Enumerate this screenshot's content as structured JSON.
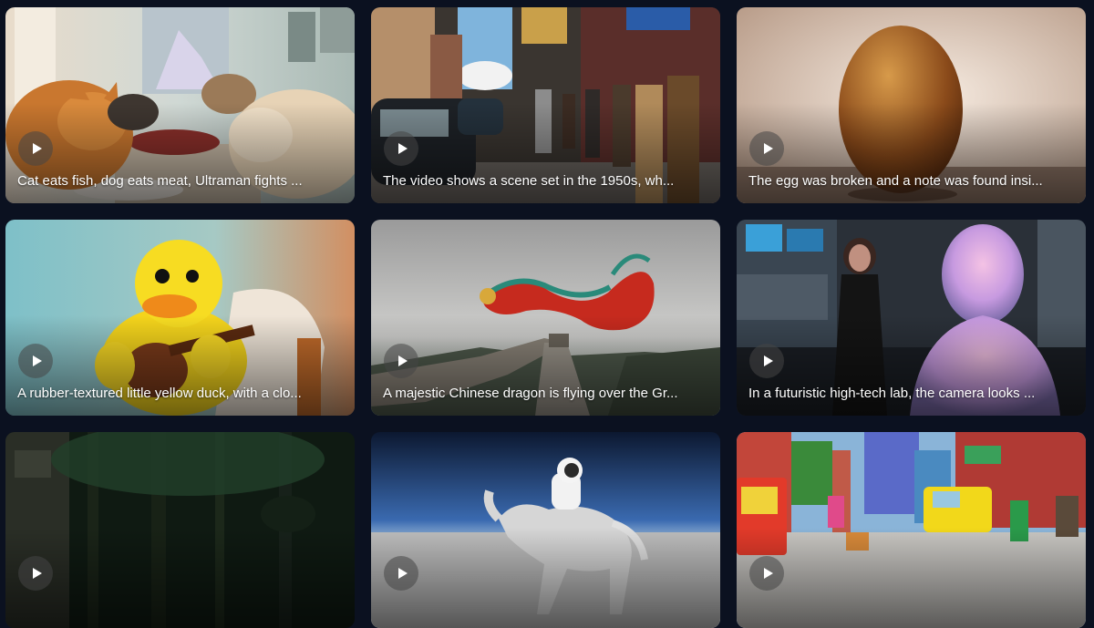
{
  "colors": {
    "page_background": "#0b1120",
    "caption_text": "#ffffff"
  },
  "gallery": {
    "cards": [
      {
        "caption": "Cat eats fish, dog eats meat, Ultraman fights ...",
        "play_icon": "play-icon"
      },
      {
        "caption": "The video shows a scene set in the 1950s, wh...",
        "play_icon": "play-icon"
      },
      {
        "caption": "The egg was broken and a note was found insi...",
        "play_icon": "play-icon"
      },
      {
        "caption": "A rubber-textured little yellow duck, with a clo...",
        "play_icon": "play-icon"
      },
      {
        "caption": "A majestic Chinese dragon is flying over the Gr...",
        "play_icon": "play-icon"
      },
      {
        "caption": "In a futuristic high-tech lab, the camera looks ...",
        "play_icon": "play-icon"
      },
      {
        "caption": "",
        "play_icon": "play-icon"
      },
      {
        "caption": "",
        "play_icon": "play-icon"
      },
      {
        "caption": "",
        "play_icon": "play-icon"
      }
    ]
  }
}
